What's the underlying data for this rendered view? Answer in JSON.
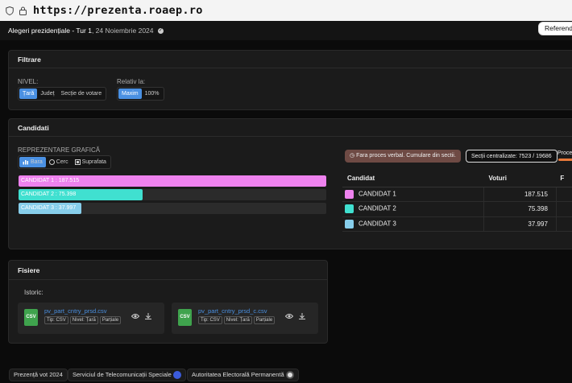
{
  "browser": {
    "url": "https://prezenta.roaep.ro"
  },
  "header": {
    "title": "Alegeri prezidențiale - Tur 1",
    "date": ", 24 Noiembrie 2024",
    "referendum_label": "Referendum"
  },
  "filters": {
    "title": "Filtrare",
    "level_label": "NIVEL:",
    "level_options": [
      "Țară",
      "Județ",
      "Secție de votare"
    ],
    "relative_label": "Relativ la:",
    "relative_options": [
      "Maxim",
      "100%"
    ]
  },
  "candidates": {
    "title": "Candidati",
    "graphic_label": "REPREZENTARE GRAFICĂ",
    "graphic_options": [
      "Bara",
      "Cerc",
      "Suprafata"
    ],
    "bars": [
      {
        "label": "CANDIDAT 1 : 187.515",
        "color": "#ee82ee",
        "fraction": 1.0
      },
      {
        "label": "CANDIDAT 2 : 75.398",
        "color": "#40e0d0",
        "fraction": 0.402
      },
      {
        "label": "CANDIDAT 3 : 37.997",
        "color": "#87ceeb",
        "fraction": 0.203
      }
    ],
    "status_pill": "Fara proces verbal. Cumulare din sectii.",
    "sections_pill": "Secții centralizate: 7523 / 19686",
    "progress_label": "Proces",
    "table_headers": [
      "Candidat",
      "Voturi",
      "F"
    ],
    "rows": [
      {
        "name": "CANDIDAT 1",
        "votes": "187.515",
        "color": "#ee82ee"
      },
      {
        "name": "CANDIDAT 2",
        "votes": "75.398",
        "color": "#40e0d0"
      },
      {
        "name": "CANDIDAT 3",
        "votes": "37.997",
        "color": "#87ceeb"
      }
    ]
  },
  "files": {
    "title": "Fisiere",
    "history_label": "Istoric:",
    "items": [
      {
        "name": "pv_part_cntry_prsd.csv",
        "tags": [
          "Tip: CSV",
          "Nivel: Țară",
          "Parțiale"
        ]
      },
      {
        "name": "pv_part_cntry_prsd_c.csv",
        "tags": [
          "Tip: CSV",
          "Nivel: Țară",
          "Parțiale"
        ]
      }
    ],
    "icon_label": "CSV"
  },
  "footer": [
    "Prezență vot 2024",
    "Serviciul de Telecomunicații Speciale",
    "Autoritatea Electorală Permanentă"
  ],
  "icons": {
    "view": "eye-icon",
    "download": "download-icon",
    "bar": "bar-chart-icon",
    "circle": "pie-icon",
    "area": "area-icon",
    "verified": "check-badge-icon"
  }
}
